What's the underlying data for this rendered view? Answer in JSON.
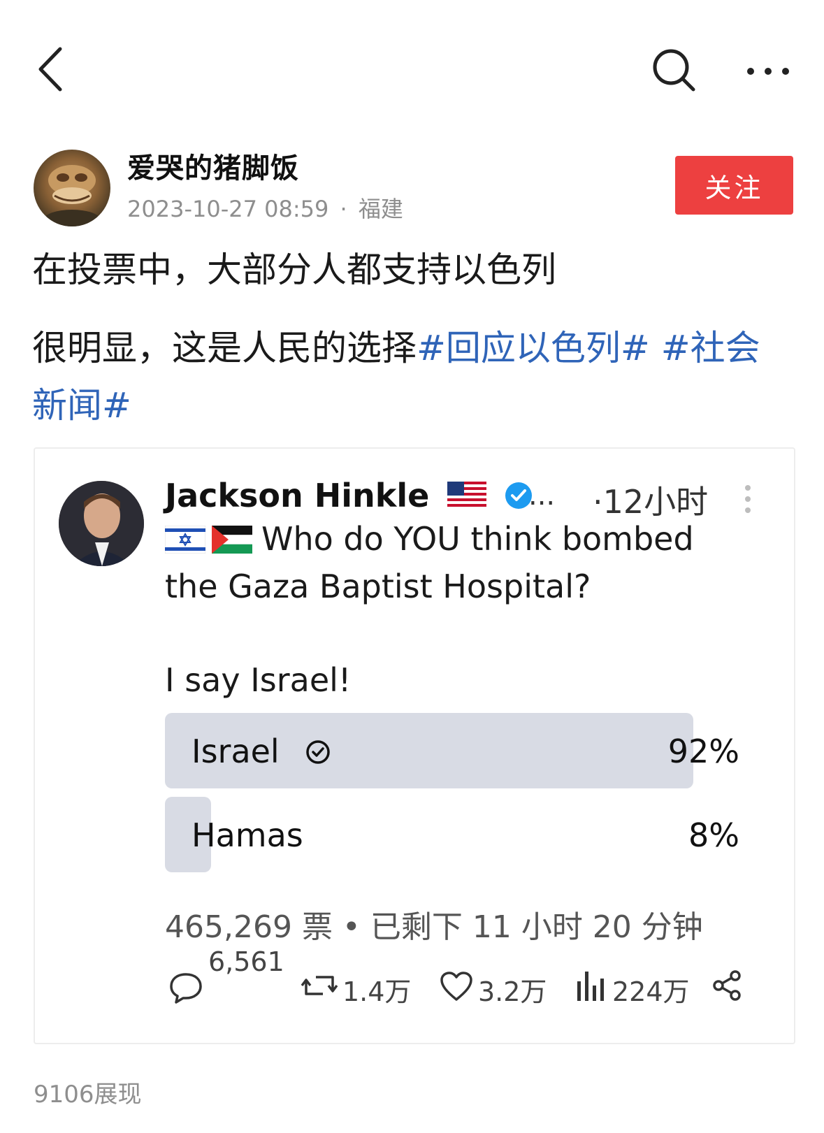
{
  "author": {
    "name": "爱哭的猪脚饭",
    "datetime": "2023-10-27 08:59",
    "separator": "·",
    "location": "福建",
    "follow_label": "关注"
  },
  "post": {
    "line1": "在投票中，大部分人都支持以色列",
    "line2_text": "很明显，这是人民的选择",
    "hashtag1": "#回应以色列#",
    "hashtag2_part1": "#社会",
    "hashtag2_part2": "新闻#"
  },
  "embedded": {
    "name": "Jackson Hinkle",
    "ellipsis": "...",
    "time": "·12小时",
    "text_line1": "Who do YOU think bombed",
    "text_line2": "the Gaza Baptist Hospital?",
    "text_line3": "I say Israel!",
    "poll": {
      "options": [
        {
          "label": "Israel",
          "percent_label": "92%",
          "fraction": 0.92,
          "selected": true
        },
        {
          "label": "Hamas",
          "percent_label": "8%",
          "fraction": 0.08,
          "selected": false
        }
      ],
      "meta": "465,269 票 • 已剩下 11 小时 20 分钟"
    },
    "stats": {
      "replies": "6,561",
      "retweets": "1.4万",
      "likes": "3.2万",
      "views": "224万"
    }
  },
  "footer": {
    "impressions": "9106展现"
  },
  "colors": {
    "follow": "#ed4040",
    "hashtag": "#2f64b8",
    "verified": "#1d9bf0",
    "poll_fill": "#d8dbe4"
  }
}
